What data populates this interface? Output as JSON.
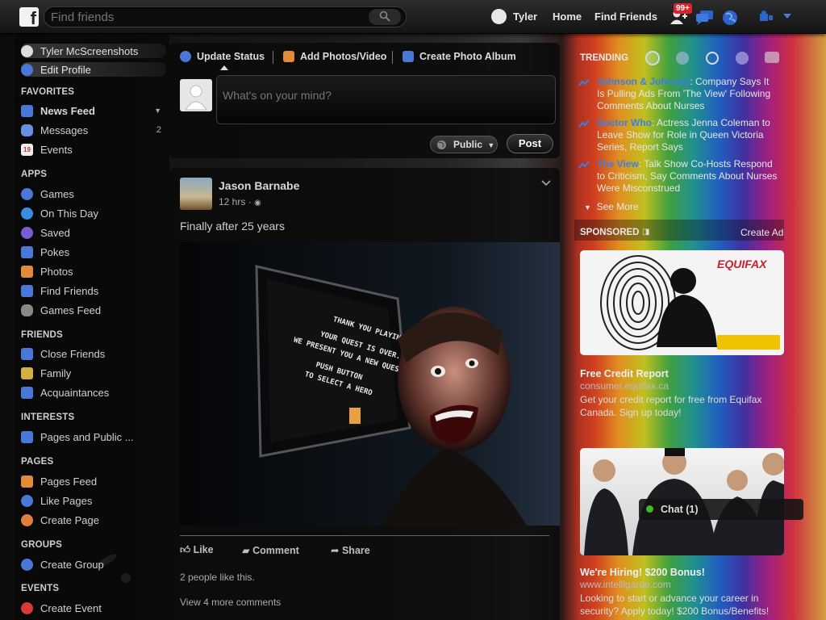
{
  "topbar": {
    "search_placeholder": "Find friends",
    "user_name": "Tyler",
    "home": "Home",
    "find_friends": "Find Friends",
    "friend_requests_badge": "99+"
  },
  "left": {
    "profile_name": "Tyler McScreenshots",
    "edit_profile": "Edit Profile",
    "favorites_header": "FAVORITES",
    "favorites": [
      {
        "label": "News Feed",
        "icon": "news-feed-icon"
      },
      {
        "label": "Messages",
        "count": "2",
        "icon": "messages-icon"
      },
      {
        "label": "Events",
        "icon": "events-calendar-icon",
        "icon_text": "19"
      }
    ],
    "apps_header": "APPS",
    "apps": [
      {
        "label": "Games",
        "icon": "games-icon"
      },
      {
        "label": "On This Day",
        "icon": "on-this-day-icon"
      },
      {
        "label": "Saved",
        "icon": "saved-icon"
      },
      {
        "label": "Pokes",
        "icon": "pokes-icon"
      },
      {
        "label": "Photos",
        "icon": "photos-icon"
      },
      {
        "label": "Find Friends",
        "icon": "find-friends-icon"
      },
      {
        "label": "Games Feed",
        "icon": "games-feed-icon"
      }
    ],
    "friends_header": "FRIENDS",
    "friends": [
      {
        "label": "Close Friends",
        "icon": "close-friends-icon"
      },
      {
        "label": "Family",
        "icon": "family-icon"
      },
      {
        "label": "Acquaintances",
        "icon": "acquaintances-icon"
      }
    ],
    "interests_header": "INTERESTS",
    "interests": [
      {
        "label": "Pages and Public ...",
        "icon": "pages-public-icon"
      }
    ],
    "pages_header": "PAGES",
    "pages": [
      {
        "label": "Pages Feed",
        "icon": "pages-feed-icon"
      },
      {
        "label": "Like Pages",
        "icon": "like-pages-icon"
      },
      {
        "label": "Create Page",
        "icon": "create-page-icon"
      }
    ],
    "groups_header": "GROUPS",
    "groups": [
      {
        "label": "Create Group",
        "icon": "create-group-icon"
      }
    ],
    "events_header": "EVENTS",
    "events": [
      {
        "label": "Create Event",
        "icon": "create-event-icon"
      }
    ]
  },
  "composer": {
    "tab_status": "Update Status",
    "tab_photos": "Add Photos/Video",
    "tab_album": "Create Photo Album",
    "placeholder": "What's on your mind?",
    "privacy": "Public",
    "post": "Post"
  },
  "post": {
    "author": "Jason Barnabe",
    "time": "12 hrs ·",
    "text": "Finally after 25 years",
    "screen_text": [
      "THANK YOU PLAYING",
      "YOUR QUEST IS OVER.",
      "WE PRESENT YOU A NEW QUEST.",
      "PUSH BUTTON",
      "TO SELECT A HERO"
    ],
    "like": "Like",
    "comment": "Comment",
    "share": "Share",
    "likes_people": "2 people",
    "likes_suffix": "like this.",
    "view_more": "View 4 more comments"
  },
  "right": {
    "trending_header": "TRENDING",
    "trending": [
      {
        "topic": "Johnson & Johnson",
        "text": ": Company Says It Is Pulling Ads From 'The View' Following Comments About Nurses"
      },
      {
        "topic": "Doctor Who",
        "text": ": Actress Jenna Coleman to Leave Show for Role in Queen Victoria Series, Report Says"
      },
      {
        "topic": "The View",
        "text": ": Talk Show Co-Hosts Respond to Criticism, Say Comments About Nurses Were Misconstrued"
      }
    ],
    "see_more": "See More",
    "sponsored_header": "SPONSORED",
    "create_ad": "Create Ad",
    "ad1": {
      "brand": "EQUIFAX",
      "title": "Free Credit Report",
      "url": "consumer.equifax.ca",
      "desc": "Get your credit report for free from Equifax Canada. Sign up today!"
    },
    "ad2": {
      "title": "We're Hiring! $200 Bonus!",
      "url": "www.intelligarde.com",
      "desc": "Looking to start or advance your career in security? Apply today! $200 Bonus/Benefits!"
    }
  },
  "chat": {
    "label": "Chat (1)"
  },
  "colors": {
    "link_blue": "#3a7ee8",
    "badge_red": "#d9232e"
  }
}
